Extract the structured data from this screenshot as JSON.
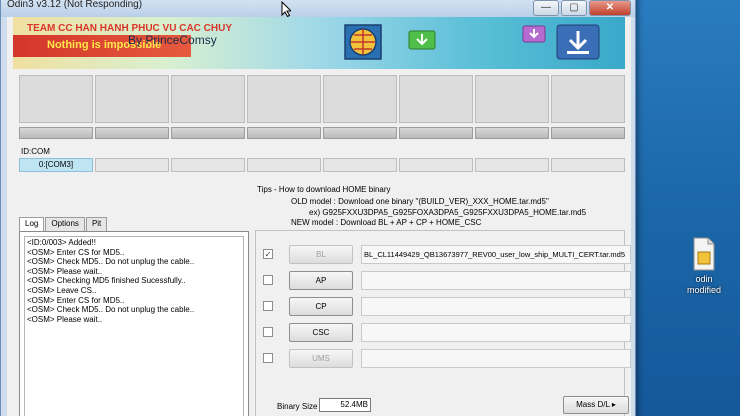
{
  "window": {
    "title": "Odin3 v3.12 (Not Responding)",
    "min_label": "—",
    "max_label": "▢",
    "close_label": "✕"
  },
  "banner": {
    "team": "TEAM CC HAN HANH PHUC VU CAC CHUY",
    "tagline": "Nothing is impossible",
    "author": "By PrinceComsy"
  },
  "id_com": {
    "label": "ID:COM",
    "port": "0:[COM3]"
  },
  "log_tabs": [
    {
      "label": "Log"
    },
    {
      "label": "Options"
    },
    {
      "label": "Pit"
    }
  ],
  "log_lines": [
    "<ID:0/003> Added!!",
    "<OSM> Enter CS for MD5..",
    "<OSM> Check MD5.. Do not unplug the cable..",
    "<OSM> Please wait..",
    "<OSM> Checking MD5 finished Sucessfully..",
    "<OSM> Leave CS..",
    "<OSM> Enter CS for MD5..",
    "<OSM> Check MD5.. Do not unplug the cable..",
    "<OSM> Please wait.."
  ],
  "tips": {
    "title": "Tips - How to download HOME binary",
    "old_model": "OLD model  : Download one binary   \"(BUILD_VER)_XXX_HOME.tar.md5\"",
    "example": "ex) G925FXXU3DPA5_G925FOXA3DPA5_G925FXXU3DPA5_HOME.tar.md5",
    "new_model": "NEW model : Download BL + AP + CP + HOME_CSC"
  },
  "files": [
    {
      "label": "BL",
      "checked": true,
      "check_glyph": "✓",
      "enabled": false,
      "path": "BL_CL11449429_QB13673977_REV00_user_low_ship_MULTI_CERT.tar.md5"
    },
    {
      "label": "AP",
      "checked": false,
      "check_glyph": "",
      "enabled": true,
      "path": ""
    },
    {
      "label": "CP",
      "checked": false,
      "check_glyph": "",
      "enabled": true,
      "path": ""
    },
    {
      "label": "CSC",
      "checked": false,
      "check_glyph": "",
      "enabled": true,
      "path": ""
    },
    {
      "label": "UMS",
      "checked": false,
      "check_glyph": "",
      "enabled": false,
      "path": ""
    }
  ],
  "binary_size": {
    "label": "Binary Size",
    "value": "52.4MB"
  },
  "mass_dl": {
    "label": "Mass D/L ▸"
  },
  "desktop_icon": {
    "label_line1": "odin",
    "label_line2": "modified"
  },
  "colors": {
    "banner_red": "#d3362a",
    "banner_yellow": "#ffe94a",
    "com_active": "#bfe4f2",
    "desktop": "#1e6fb0"
  }
}
